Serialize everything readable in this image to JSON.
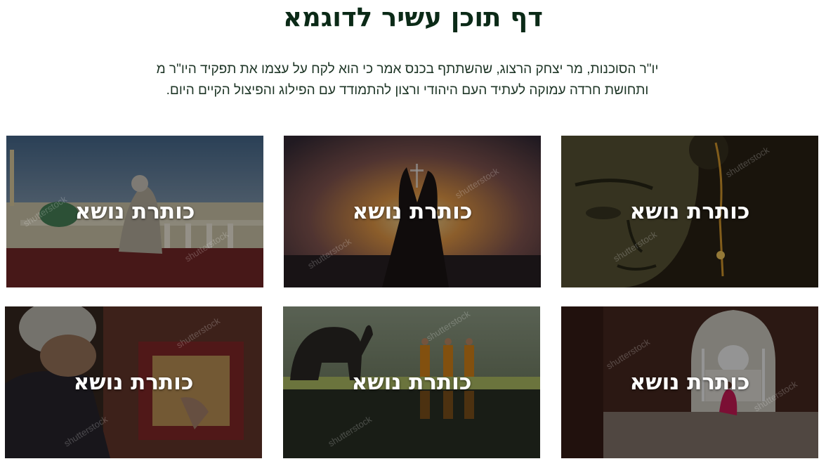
{
  "page": {
    "title": "דף תוכן עשיר לדוגמא",
    "intro_line1": "יו\"ר הסוכנות, מר יצחק הרצוג, שהשתתף בכנס אמר כי הוא לקח על עצמו את תפקיד היו\"ר מ",
    "intro_line2": "ותחושת חרדה עמוקה לעתיד העם היהודי ורצון להתמודד עם הפילוג והפיצול הקיים היום."
  },
  "cards": [
    {
      "title": "כותרת נושא",
      "scene": "praying-man-mosque-courtyard"
    },
    {
      "title": "כותרת נושא",
      "scene": "hands-raised-at-sunset"
    },
    {
      "title": "כותרת נושא",
      "scene": "buddha-face-with-incense"
    },
    {
      "title": "כותרת נושא",
      "scene": "man-praying-on-rug"
    },
    {
      "title": "כותרת נושא",
      "scene": "monks-and-elephant-by-water"
    },
    {
      "title": "כותרת נושא",
      "scene": "woman-in-arch-taj-mahal"
    }
  ],
  "watermark": "shutterstock",
  "colors": {
    "title": "#0b2a17",
    "intro": "#1e3526",
    "overlay_text": "#ffffff"
  }
}
